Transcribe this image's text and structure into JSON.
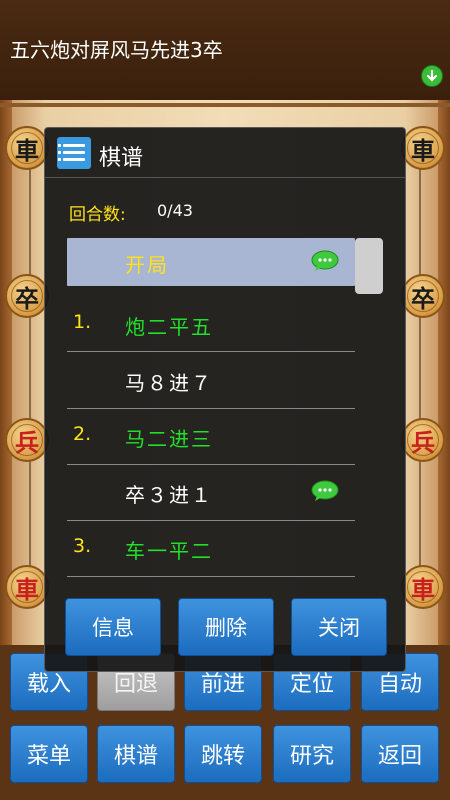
{
  "header": {
    "title": "五六炮对屏风马先进3卒"
  },
  "board": {
    "pieces_left": [
      {
        "char": "車",
        "side": "black"
      },
      {
        "char": "卒",
        "side": "black"
      },
      {
        "char": "兵",
        "side": "red"
      },
      {
        "char": "車",
        "side": "red"
      }
    ],
    "pieces_right": [
      {
        "char": "車",
        "side": "black"
      },
      {
        "char": "卒",
        "side": "black"
      },
      {
        "char": "兵",
        "side": "red"
      },
      {
        "char": "車",
        "side": "red"
      }
    ]
  },
  "dialog": {
    "title": "棋谱",
    "round_label": "回合数:",
    "round_value": "0/43",
    "start_label": "开局",
    "moves": [
      {
        "num": "1.",
        "text": "炮二平五",
        "color": "#22e02a",
        "has_comment": false
      },
      {
        "num": "",
        "text": "马８进７",
        "color": "#ffffff",
        "has_comment": false
      },
      {
        "num": "2.",
        "text": "马二进三",
        "color": "#22e02a",
        "has_comment": false
      },
      {
        "num": "",
        "text": "卒３进１",
        "color": "#ffffff",
        "has_comment": true
      },
      {
        "num": "3.",
        "text": "车一平二",
        "color": "#22e02a",
        "has_comment": false
      }
    ],
    "buttons": {
      "info": "信息",
      "delete": "删除",
      "close": "关闭"
    }
  },
  "toolbar": {
    "row1": [
      "载入",
      "回退",
      "前进",
      "定位",
      "自动"
    ],
    "row2": [
      "菜单",
      "棋谱",
      "跳转",
      "研究",
      "返回"
    ]
  },
  "colors": {
    "accent_blue": "#2a7fd0",
    "move_red_side": "#22e02a",
    "label_yellow": "#ffe21a"
  }
}
